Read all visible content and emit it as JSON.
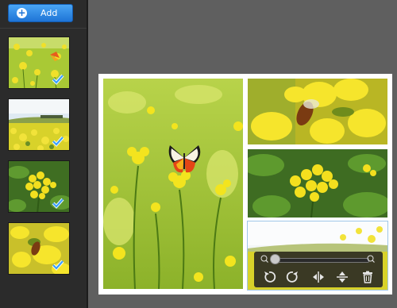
{
  "toolbar": {
    "add_label": "Add"
  },
  "thumbnails": [
    {
      "name": "butterfly-photo",
      "selected": true
    },
    {
      "name": "field-photo",
      "selected": true
    },
    {
      "name": "flower-cluster-photo",
      "selected": true
    },
    {
      "name": "bee-photo",
      "selected": true
    }
  ],
  "collage": {
    "cells": [
      "butterfly-photo",
      "bee-photo",
      "flower-cluster-photo",
      "field-photo"
    ],
    "zoom_level": 0.0,
    "tools": [
      "rotate-left-icon",
      "rotate-right-icon",
      "flip-horizontal-icon",
      "flip-vertical-icon",
      "delete-icon"
    ]
  },
  "colors": {
    "accent": "#1f74d6",
    "check": "#3aa0ff",
    "yellow": "#f2e33a",
    "green": "#5c8a1e"
  }
}
